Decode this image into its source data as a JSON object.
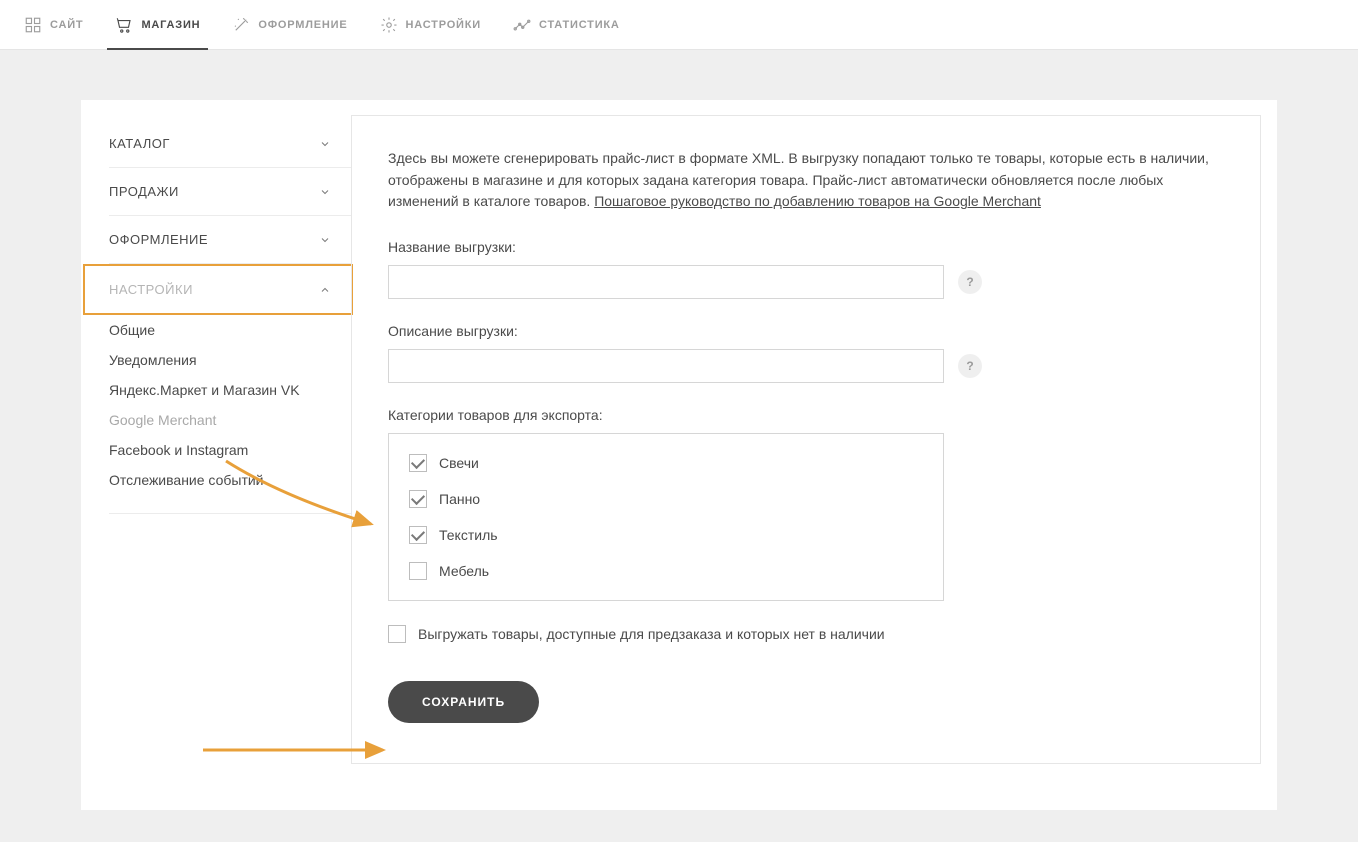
{
  "topnav": {
    "items": [
      {
        "label": "САЙТ",
        "icon": "grid-icon"
      },
      {
        "label": "МАГАЗИН",
        "icon": "cart-icon",
        "active": true
      },
      {
        "label": "ОФОРМЛЕНИЕ",
        "icon": "wand-icon"
      },
      {
        "label": "НАСТРОЙКИ",
        "icon": "gear-icon"
      },
      {
        "label": "СТАТИСТИКА",
        "icon": "chart-icon"
      }
    ]
  },
  "sidebar": {
    "sections": [
      {
        "label": "КАТАЛОГ",
        "expanded": false
      },
      {
        "label": "ПРОДАЖИ",
        "expanded": false
      },
      {
        "label": "ОФОРМЛЕНИЕ",
        "expanded": false
      },
      {
        "label": "НАСТРОЙКИ",
        "expanded": true,
        "highlighted": true,
        "items": [
          {
            "label": "Общие"
          },
          {
            "label": "Уведомления"
          },
          {
            "label": "Яндекс.Маркет и Магазин VK"
          },
          {
            "label": "Google Merchant",
            "active": true
          },
          {
            "label": "Facebook и Instagram"
          },
          {
            "label": "Отслеживание событий"
          }
        ]
      }
    ]
  },
  "main": {
    "intro_text": "Здесь вы можете сгенерировать прайс-лист в формате XML. В выгрузку попадают только те товары, которые есть в наличии, отображены в магазине и для которых задана категория товара. Прайс-лист автоматически обновляется после любых изменений в каталоге товаров. ",
    "intro_link": "Пошаговое руководство по добавлению товаров на Google Merchant",
    "export_name_label": "Название выгрузки:",
    "export_name_value": "",
    "export_desc_label": "Описание выгрузки:",
    "export_desc_value": "",
    "categories_label": "Категории товаров для экспорта:",
    "categories": [
      {
        "label": "Свечи",
        "checked": true
      },
      {
        "label": "Панно",
        "checked": true
      },
      {
        "label": "Текстиль",
        "checked": true
      },
      {
        "label": "Мебель",
        "checked": false
      }
    ],
    "preorder_label": "Выгружать товары, доступные для предзаказа и которых нет в наличии",
    "preorder_checked": false,
    "save_label": "СОХРАНИТЬ",
    "help_glyph": "?"
  },
  "annotations": {
    "color": "#e8a03a"
  }
}
